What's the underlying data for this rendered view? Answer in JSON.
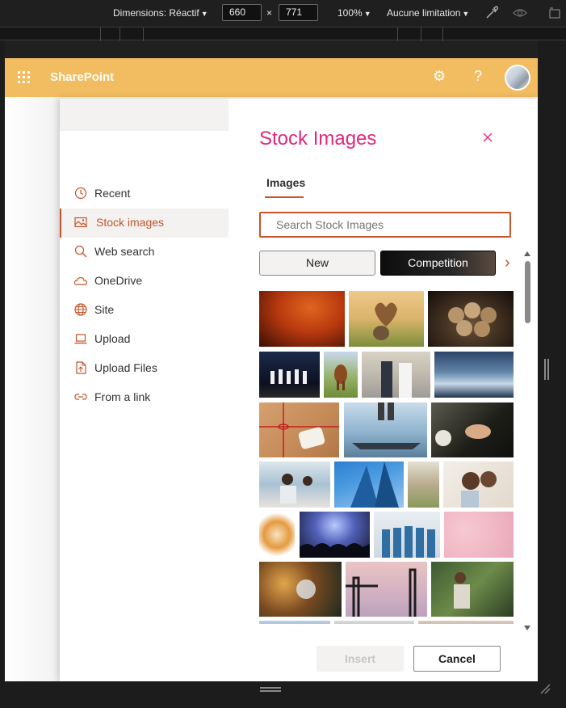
{
  "devtools": {
    "dimensions_label": "Dimensions: Réactif",
    "width_value": "660",
    "times": "×",
    "height_value": "771",
    "zoom": "100%",
    "throttle": "Aucune limitation",
    "dropdown_glyph": "▼"
  },
  "header": {
    "app_title": "SharePoint",
    "settings_glyph": "⚙",
    "help_glyph": "?",
    "accent_color": "#f2bd61"
  },
  "nav": {
    "items": [
      {
        "label": "Recent",
        "icon": "clock-icon"
      },
      {
        "label": "Stock images",
        "icon": "image-icon",
        "active": true
      },
      {
        "label": "Web search",
        "icon": "search-icon"
      },
      {
        "label": "OneDrive",
        "icon": "cloud-icon"
      },
      {
        "label": "Site",
        "icon": "globe-icon"
      },
      {
        "label": "Upload",
        "icon": "laptop-icon"
      },
      {
        "label": "Upload Files",
        "icon": "file-upload-icon"
      },
      {
        "label": "From a link",
        "icon": "link-icon"
      }
    ]
  },
  "panel": {
    "title": "Stock Images",
    "tab": "Images",
    "search_placeholder": "Search Stock Images",
    "categories": [
      "New",
      "Competition"
    ],
    "next_glyph": "›",
    "insert_label": "Insert",
    "cancel_label": "Cancel",
    "title_color": "#e3267e",
    "accent_color": "#c5542b"
  }
}
